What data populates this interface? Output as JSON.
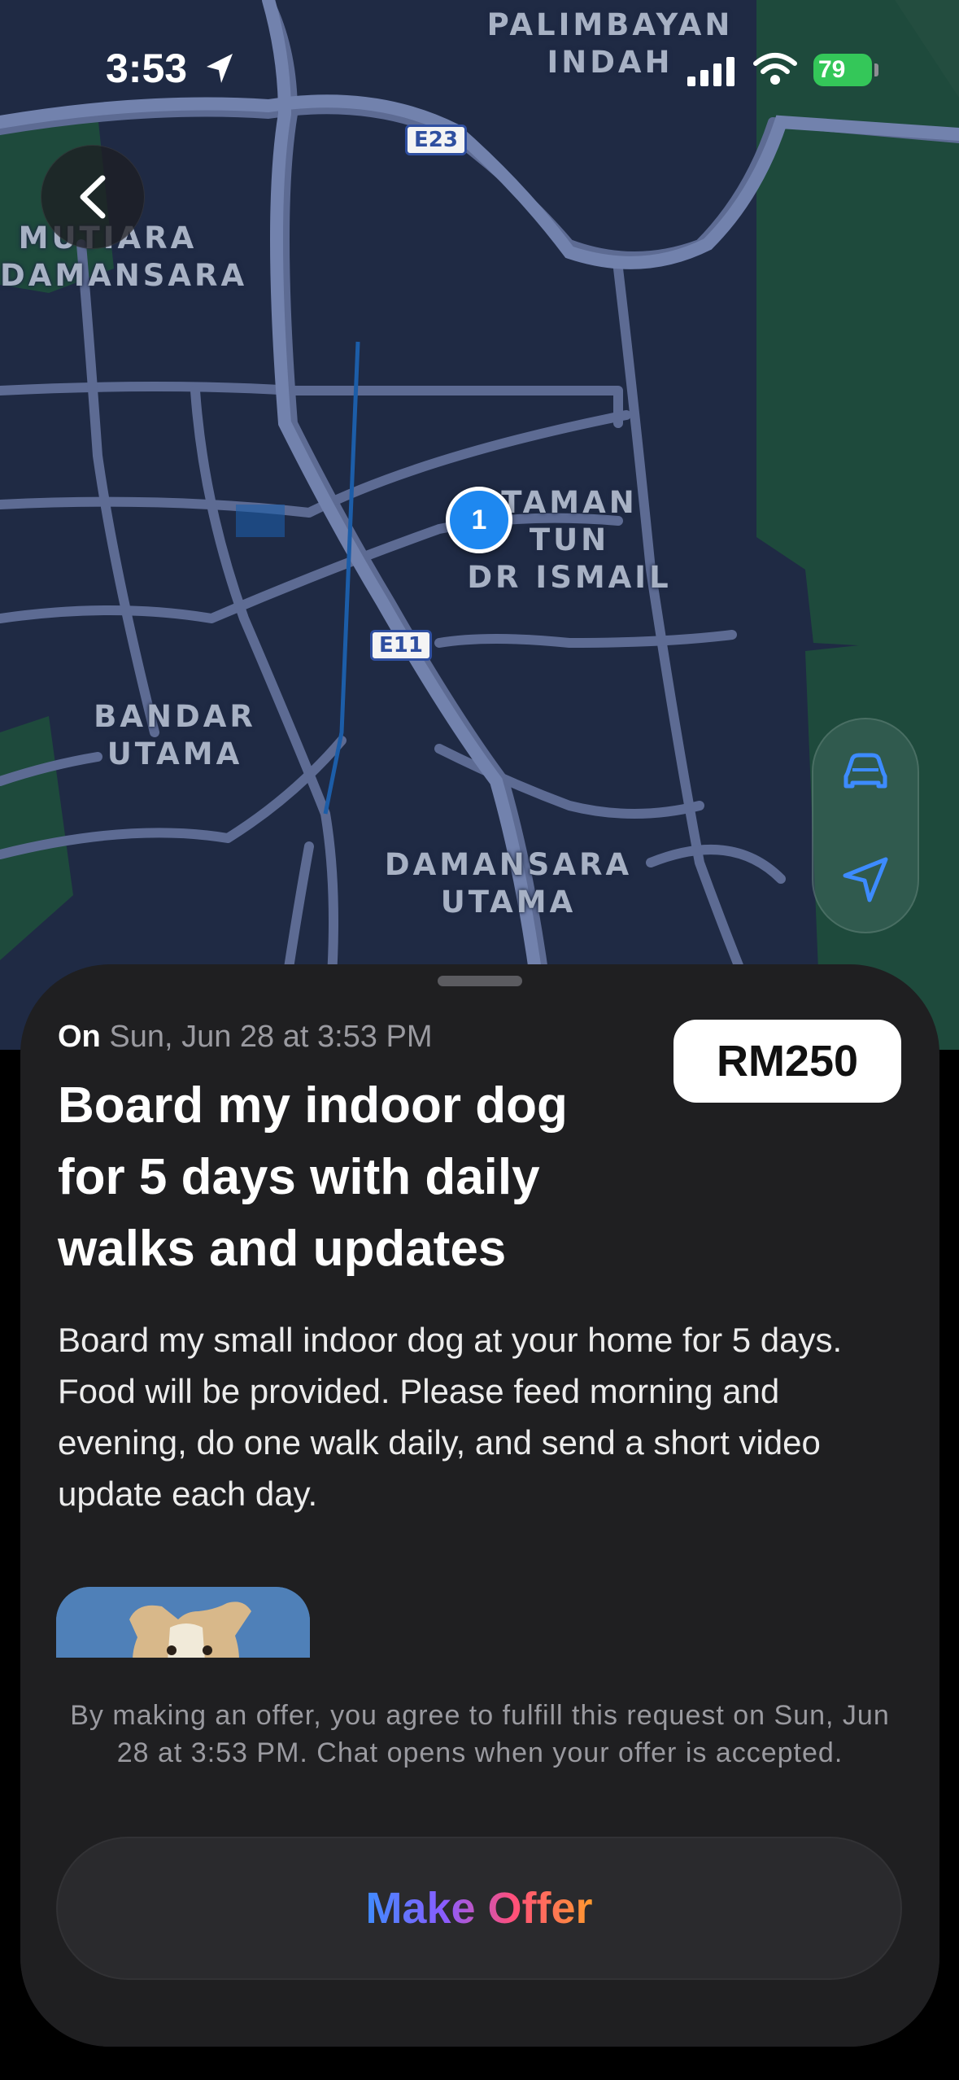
{
  "status_bar": {
    "time": "3:53",
    "battery": "79"
  },
  "map": {
    "labels": {
      "palimbayan": "PALIMBAYAN INDAH",
      "mutiara": "MUTIARA\nDAMANSARA",
      "taman": "TAMAN TUN\nDR ISMAIL",
      "bandar": "BANDAR\nUTAMA",
      "damansara_utama": "DAMANSARA\nUTAMA"
    },
    "shields": {
      "e23": "E23",
      "e11": "E11"
    },
    "pin_count": "1",
    "colors": {
      "land": "#1f2a44",
      "road": "#5a6a92",
      "park": "#1e4a3c"
    }
  },
  "sheet": {
    "date_prefix": "On",
    "date": "Sun, Jun 28 at 3:53 PM",
    "price": "RM250",
    "title": "Board my indoor dog for 5 days with daily walks and updates",
    "description": "Board my small indoor dog at your home for 5 days. Food will be provided. Please feed morning and evening, do one walk daily, and send a short video update each day.",
    "disclaimer": "By making an offer, you agree to fulfill this request on Sun, Jun 28 at 3:53 PM. Chat opens when your offer is accepted.",
    "button_label": "Make Offer"
  },
  "icons": {
    "back": "chevron-left-icon",
    "car": "car-icon",
    "locate": "location-arrow-icon"
  }
}
